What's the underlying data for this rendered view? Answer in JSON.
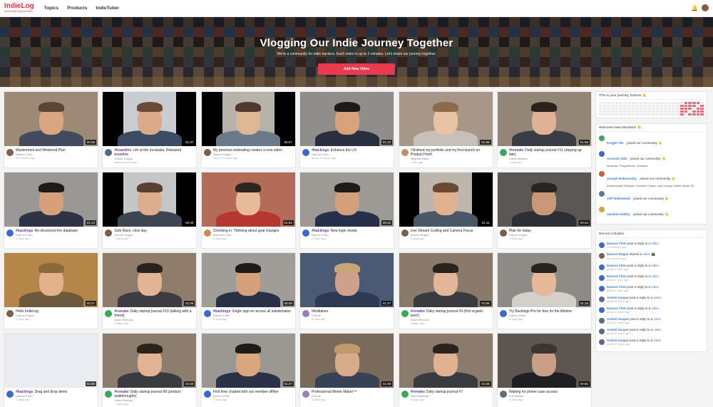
{
  "brand": {
    "name": "IndieLog",
    "tagline": "the friendly vlog for indies",
    "accent": "#e8334a"
  },
  "nav": [
    "Topics",
    "Products",
    "IndieTuber"
  ],
  "hero": {
    "title": "Vlogging Our Indie Journey Together",
    "subtitle": "We're a community for indie hackers. Each video is up to 2 minutes. Let's share our journey together.",
    "button": "Add New Video"
  },
  "videos": [
    {
      "tag": "",
      "title": "Mastermind and Weekend Plan",
      "author": "Damon Chen",
      "when": "44 minutes ago",
      "duration": "00:58",
      "bg": "#9c8a76",
      "face": "#d9a582",
      "hair": "#5b4535",
      "body": "#444a5e",
      "bars": false,
      "av": "#8a5a44"
    },
    {
      "tag": "#boardme",
      "title": "Life at the Incubator, Released boardme",
      "author": "Jordan Caspar",
      "when": "about 9 hours ago",
      "duration": "01:37",
      "bg": "#c9cdd2",
      "face": "#dba98a",
      "hair": "#6b4a3a",
      "body": "#3c4b63",
      "bars": true,
      "av": "#546a8a"
    },
    {
      "tag": "",
      "title": "My previous estimating creates a new video",
      "author": "Damon Rogan",
      "when": "about 19 hours ago",
      "duration": "00:07",
      "bg": "#b7b3aa",
      "face": "#e0b795",
      "hair": "#4e3a2e",
      "body": "#6a7a8a",
      "bars": true,
      "av": "#7b5d49"
    },
    {
      "tag": "#backlogs",
      "title": "Enhance the UX",
      "author": "Damon Chen",
      "when": "about 20 hours ago",
      "duration": "01:22",
      "bg": "#8f8e8a",
      "face": "#d8a27b",
      "hair": "#1e1a18",
      "body": "#2b3040",
      "bars": false,
      "av": "#3a6ad0"
    },
    {
      "tag": "",
      "title": "I finished my portfolio and my first launch on Product Hunt!",
      "author": "Meghan Wade",
      "when": "1 day ago",
      "duration": "01:56",
      "bg": "#a79788",
      "face": "#e8c3a4",
      "hair": "#8c6a4a",
      "body": "#c7c0b8",
      "bars": false,
      "av": "#c48a6a"
    },
    {
      "tag": "#remake",
      "title": "Daily startup journal #11 (staying up late)",
      "author": "David Miranda",
      "when": "1 day ago",
      "duration": "01:58",
      "bg": "#948677",
      "face": "#e0b295",
      "hair": "#2b221c",
      "body": "#3a3c44",
      "bars": false,
      "av": "#3aa85a"
    },
    {
      "tag": "#backlogs",
      "title": "Re-structured the database",
      "author": "Damon Chen",
      "when": "2 days ago",
      "duration": "01:12",
      "bg": "#9a9894",
      "face": "#d6a07a",
      "hair": "#1e1a18",
      "body": "#2d3345",
      "bars": false,
      "av": "#3a6ad0"
    },
    {
      "tag": "",
      "title": "Solo Race, slow day",
      "author": "Damon Rogan",
      "when": "2 days ago",
      "duration": "00:40",
      "bg": "#c4c6c8",
      "face": "#dcae8e",
      "hair": "#5a4030",
      "body": "#3d4550",
      "bars": true,
      "av": "#7b5d49"
    },
    {
      "tag": "",
      "title": "Checking in. Thinking about goal changes",
      "author": "Brandon Chan",
      "when": "2 days ago",
      "duration": "01:54",
      "bg": "#b36c58",
      "face": "#e7bb9a",
      "hair": "#2e2420",
      "body": "#b5372f",
      "bars": false,
      "av": "#d08a4a"
    },
    {
      "tag": "#backlogs",
      "title": "New login modal",
      "author": "Damon Chen",
      "when": "2 days ago",
      "duration": "00:42",
      "bg": "#9d9a96",
      "face": "#d4a07c",
      "hair": "#1e1a18",
      "body": "#27304a",
      "bars": false,
      "av": "#3a6ad0"
    },
    {
      "tag": "",
      "title": "Live Stream Coding and Camera Focus",
      "author": "Damon Rogan",
      "when": "3 days ago",
      "duration": "01:11",
      "bg": "#bcb6ad",
      "face": "#e0b291",
      "hair": "#6b4a34",
      "body": "#4a5766",
      "bars": true,
      "av": "#7b5d49"
    },
    {
      "tag": "",
      "title": "Plan for today",
      "author": "Damon Rogan",
      "when": "4 days ago",
      "duration": "00:34",
      "bg": "#5a5754",
      "face": "#c99879",
      "hair": "#2a2420",
      "body": "#2c2f35",
      "bars": false,
      "av": "#7b5d49"
    },
    {
      "tag": "",
      "title": "Hello IndieLog",
      "author": "Damon Rogan",
      "when": "4 days ago",
      "duration": "00:27",
      "bg": "#b48648",
      "face": "#e3b28c",
      "hair": "#8a6a3a",
      "body": "#6d5a3c",
      "bars": false,
      "av": "#7b5d49"
    },
    {
      "tag": "#remake",
      "title": "Daily startup journal #10 (talking with a friend)",
      "author": "David Miranda",
      "when": "5 days ago",
      "duration": "01:59",
      "bg": "#8f7c6a",
      "face": "#e2b394",
      "hair": "#2a221c",
      "body": "#3c3c42",
      "bars": false,
      "av": "#3aa85a"
    },
    {
      "tag": "#backlogs",
      "title": "Single sign-on across all subdomains",
      "author": "Damon Chen",
      "when": "5 days ago",
      "duration": "00:49",
      "bg": "#a09d99",
      "face": "#d5a17d",
      "hair": "#1e1a18",
      "body": "#2a3147",
      "bars": false,
      "av": "#3a6ad0"
    },
    {
      "tag": "",
      "title": "Meditation",
      "author": "Charlie",
      "when": "5 days ago",
      "duration": "01:37",
      "bg": "#4a5a74",
      "face": "#cfa08a",
      "hair": "#c9a57a",
      "body": "#2e3a54",
      "bars": false,
      "av": "#9a7fba"
    },
    {
      "tag": "#remake",
      "title": "Daily startup journal #9 (first organic user!)",
      "author": "David Miranda",
      "when": "6 days ago",
      "duration": "01:59",
      "bg": "#897a6c",
      "face": "#e3b697",
      "hair": "#2a221c",
      "body": "#3a3b40",
      "bars": false,
      "av": "#3aa85a"
    },
    {
      "tag": "",
      "title": "Try Backlogs Pro for free for the lifetime",
      "author": "Damon Chen",
      "when": "6 days ago",
      "duration": "01:18",
      "bg": "#8e8a86",
      "face": "#e4b898",
      "hair": "#2a221c",
      "body": "#d4cfc8",
      "bars": false,
      "av": "#3a6ad0"
    },
    {
      "tag": "#backlogs",
      "title": "Drag and drop demo",
      "author": "Damon Chen",
      "when": "7 days ago",
      "duration": "01:58",
      "bg": "#e9ecf1",
      "face": "#e9ecf1",
      "hair": "#e9ecf1",
      "body": "#e9ecf1",
      "bars": false,
      "av": "#3a6ad0"
    },
    {
      "tag": "#remake",
      "title": "Daily startup journal #8 (product walkthroughs)",
      "author": "David Miranda",
      "when": "7 days ago",
      "duration": "01:59",
      "bg": "#8d7d6f",
      "face": "#e1b393",
      "hair": "#2a221c",
      "body": "#3a3b40",
      "bars": false,
      "av": "#3aa85a"
    },
    {
      "tag": "",
      "title": "First time chatted with our member offline",
      "author": "Damon Chen",
      "when": "7 days ago",
      "duration": "01:27",
      "bg": "#9b9793",
      "face": "#d9a680",
      "hair": "#1e1a18",
      "body": "#2b3146",
      "bars": false,
      "av": "#3a6ad0"
    },
    {
      "tag": "",
      "title": "Professional Meme Maker™",
      "author": "Charlie",
      "when": "8 days ago",
      "duration": "01:59",
      "bg": "#7a6a5c",
      "face": "#d8aa8c",
      "hair": "#c19a6c",
      "body": "#384256",
      "bars": false,
      "av": "#9a7fba"
    },
    {
      "tag": "#remake",
      "title": "Daily startup journal #7",
      "author": "David Miranda",
      "when": "8 days ago",
      "duration": "01:59",
      "bg": "#8a7b6d",
      "face": "#e0b292",
      "hair": "#2a221c",
      "body": "#3a3b40",
      "bars": false,
      "av": "#3aa85a"
    },
    {
      "tag": "",
      "title": "Waiting for phone case access",
      "author": "Erik Boston",
      "when": "8 days ago",
      "duration": "00:55",
      "bg": "#5c5550",
      "face": "#c9a086",
      "hair": "#3a3634",
      "body": "#1f2024",
      "bars": false,
      "av": "#6a6a6a"
    }
  ],
  "journey": {
    "title": "This is your journey, Damon 👋"
  },
  "welcome": {
    "title": "Welcome New Members 👋",
    "members": [
      {
        "name": "Insight Tile",
        "rest": "joined our community 👋",
        "bio": "",
        "av": "#3aa85a"
      },
      {
        "name": "Acoustic Nitz",
        "rest": "joined our community 👋",
        "bio": "Musician, Programmer, Dreamer",
        "av": "#3a6ad0"
      },
      {
        "name": "Joseph Rekavarsky",
        "rest": "joined our community 👋",
        "bio": "Architectural Designer, Content Creator, and a huge Coffee addict ☕",
        "av": "#c4633a"
      },
      {
        "name": "Jeff Volkerwald",
        "rest": "joined our community 👋",
        "bio": "",
        "av": "#5a7aa0"
      },
      {
        "name": "Jackson Kelley",
        "rest": "joined our community 👋",
        "bio": "",
        "av": "#d4a04a"
      }
    ]
  },
  "activities": {
    "title": "Recent Activities",
    "items": [
      {
        "name": "Damon Chen",
        "action": "post a reply to a",
        "link": "video",
        "time": "12 minutes ago",
        "av": "#3a6ad0"
      },
      {
        "name": "Damon Rogan",
        "action": "shared a",
        "link": "video 🎬",
        "time": "44 minutes ago",
        "av": "#7b5d49"
      },
      {
        "name": "Damon Chen",
        "action": "post a reply to a",
        "link": "video",
        "time": "about 1 hour ago",
        "av": "#3a6ad0"
      },
      {
        "name": "Damon Chen",
        "action": "post a reply to a",
        "link": "video",
        "time": "about 1 hour ago",
        "av": "#3a6ad0"
      },
      {
        "name": "Damon Chen",
        "action": "post a reply to a",
        "link": "video",
        "time": "about 1 hour ago",
        "av": "#3a6ad0"
      },
      {
        "name": "Andrei Gaspar",
        "action": "post a reply to a",
        "link": "video",
        "time": "about 3 hours ago",
        "av": "#5a6a8a"
      },
      {
        "name": "Damon Chen",
        "action": "post a reply to a",
        "link": "video",
        "time": "about 4 hours ago",
        "av": "#3a6ad0"
      },
      {
        "name": "Andrei Gaspar",
        "action": "post a reply to a",
        "link": "video",
        "time": "about 6 hours ago",
        "av": "#5a6a8a"
      },
      {
        "name": "Andrei Gaspar",
        "action": "post a reply to a",
        "link": "video",
        "time": "about 6 hours ago",
        "av": "#5a6a8a"
      },
      {
        "name": "Andrei Gaspar",
        "action": "post a reply to a",
        "link": "video",
        "time": "about 6 hours ago",
        "av": "#5a6a8a"
      }
    ]
  }
}
